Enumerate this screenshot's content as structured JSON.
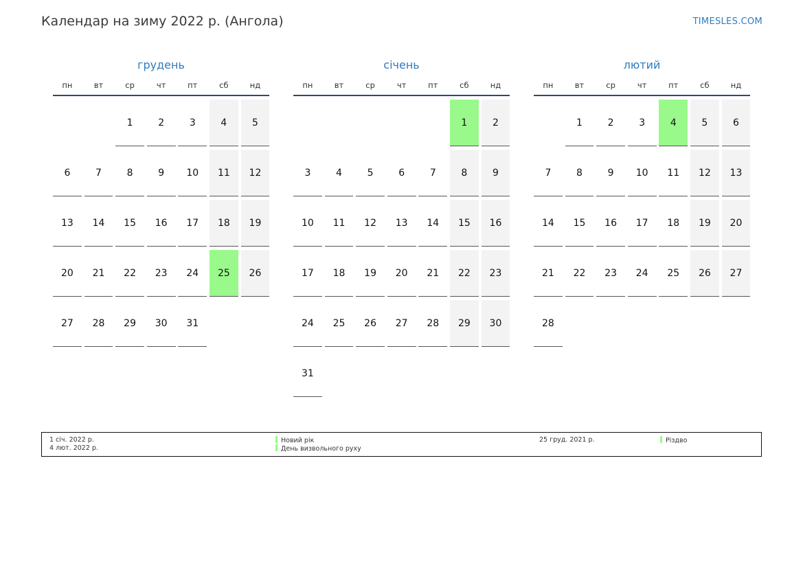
{
  "header": {
    "title": "Календар на зиму 2022 р. (Ангола)",
    "brand": "TIMESLES.COM"
  },
  "colors": {
    "accent": "#2f7bbf",
    "holiday": "#99f98b",
    "weekend": "#f3f3f3",
    "header_rule": "#2d4a6b"
  },
  "weekdays": [
    "пн",
    "вт",
    "ср",
    "чт",
    "пт",
    "сб",
    "нд"
  ],
  "months": [
    {
      "name": "грудень",
      "offset": 2,
      "days": 31,
      "holidays": [
        25
      ]
    },
    {
      "name": "січень",
      "offset": 5,
      "days": 31,
      "holidays": [
        1
      ]
    },
    {
      "name": "лютий",
      "offset": 1,
      "days": 28,
      "holidays": [
        4
      ]
    }
  ],
  "legend": {
    "left_dates": [
      "1 січ. 2022 р.",
      "4 лют. 2022 р."
    ],
    "left_names": [
      "Новий рік",
      "День визвольного руху"
    ],
    "right_dates": [
      "25 груд. 2021 р."
    ],
    "right_names": [
      "Різдво"
    ]
  }
}
